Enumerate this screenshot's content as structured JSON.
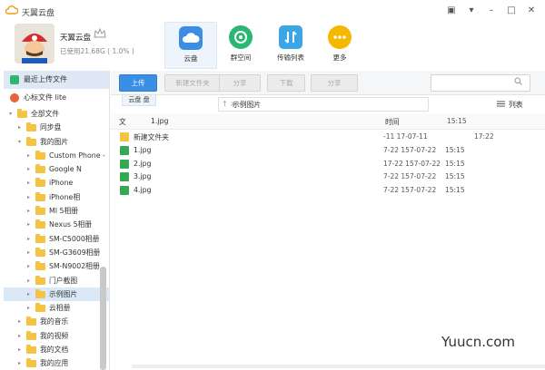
{
  "app": {
    "title": "天翼云盘"
  },
  "window_controls": {
    "feedback": "▣",
    "menu": "▾",
    "minimize": "–",
    "maximize": "□",
    "close": "✕"
  },
  "user": {
    "name": "天翼云盘",
    "storage": "已使用21.68G ( 1.0% )"
  },
  "nav": [
    {
      "label": "云盘",
      "color": "#3a8ee6",
      "icon": "cloud-icon"
    },
    {
      "label": "群空间",
      "color": "#2bb673",
      "icon": "group-space-icon"
    },
    {
      "label": "传输列表",
      "color": "#3aa6e6",
      "icon": "transfer-icon"
    },
    {
      "label": "更多",
      "color": "#f5b800",
      "icon": "more-icon"
    }
  ],
  "sidebar": {
    "recent": "最近上传文件",
    "favorites": "心标文件 lite",
    "tree": [
      {
        "label": "全部文件",
        "level": 0,
        "expanded": true
      },
      {
        "label": "同步盘",
        "level": 1,
        "expanded": false
      },
      {
        "label": "我的图片",
        "level": 1,
        "expanded": true
      },
      {
        "label": "Custom Phone -",
        "level": 2,
        "expanded": false
      },
      {
        "label": "Google N",
        "level": 2,
        "expanded": false
      },
      {
        "label": "iPhone",
        "level": 2,
        "expanded": false
      },
      {
        "label": "iPhone相",
        "level": 2,
        "expanded": false
      },
      {
        "label": "MI 5相册",
        "level": 2,
        "expanded": false
      },
      {
        "label": "Nexus 5相册",
        "level": 2,
        "expanded": false
      },
      {
        "label": "SM-C5000相册",
        "level": 2,
        "expanded": false
      },
      {
        "label": "SM-G3609相册",
        "level": 2,
        "expanded": false
      },
      {
        "label": "SM-N9002相册",
        "level": 2,
        "expanded": false
      },
      {
        "label": "门户截图",
        "level": 2,
        "expanded": false
      },
      {
        "label": "示例图片",
        "level": 2,
        "expanded": false,
        "selected": true
      },
      {
        "label": "云相册",
        "level": 2,
        "expanded": false
      },
      {
        "label": "我的音乐",
        "level": 1,
        "expanded": false
      },
      {
        "label": "我的视频",
        "level": 1,
        "expanded": false
      },
      {
        "label": "我的文档",
        "level": 1,
        "expanded": false
      },
      {
        "label": "我的应用",
        "level": 1,
        "expanded": false
      }
    ]
  },
  "toolbar": {
    "upload": "上传",
    "new_folder": "新建文件夹",
    "share": "分享",
    "download": "下载",
    "share2": "分享"
  },
  "path": {
    "chip": "云盘 盘",
    "back": "↑ >",
    "current": "示例图片",
    "view_mode": "列表"
  },
  "columns": {
    "name": "文",
    "time": "时间"
  },
  "files": [
    {
      "name": "新建文件夹",
      "type": "folder",
      "created": "-11 17-07-11",
      "modified": "17:22"
    },
    {
      "name": "1.jpg",
      "type": "image",
      "created": "7-22 157-07-22",
      "modified": "15:15"
    },
    {
      "name": "2.jpg",
      "type": "image",
      "created": "17-22 157-07-22",
      "modified": "15:15"
    },
    {
      "name": "3.jpg",
      "type": "image",
      "created": "7-22 157-07-22",
      "modified": "15:15"
    },
    {
      "name": "4.jpg",
      "type": "image",
      "created": "7-22 157-07-22",
      "modified": "15:15"
    }
  ],
  "header_row_file": {
    "name": "1.jpg",
    "time": "15:15"
  },
  "watermark": "Yuucn.com"
}
